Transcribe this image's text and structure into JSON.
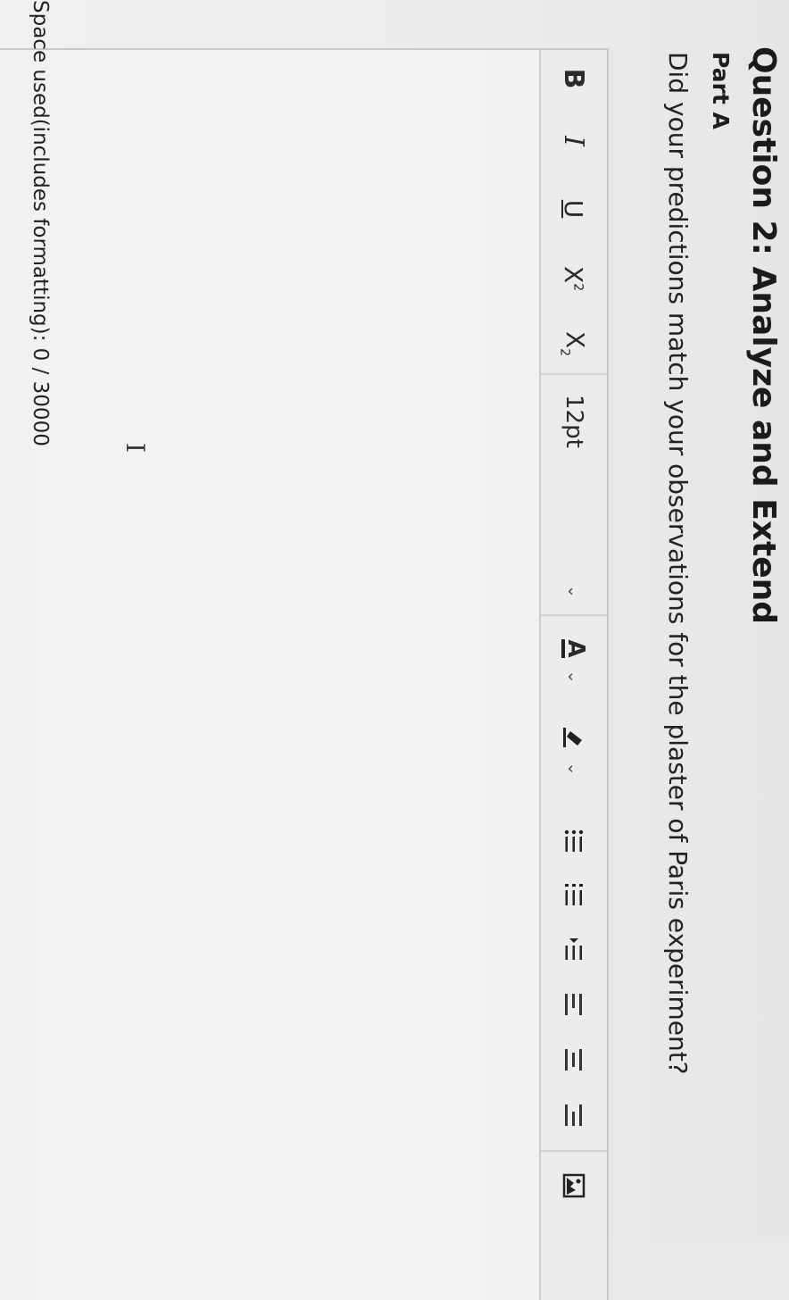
{
  "question": {
    "title": "Question 2: Analyze and Extend",
    "part": "Part A",
    "prompt": "Did your predictions match your observations for the plaster of Paris experiment?"
  },
  "toolbar": {
    "bold": "B",
    "italic": "I",
    "underline": "U",
    "superscript_base": "X",
    "superscript_mark": "2",
    "subscript_base": "X",
    "subscript_mark": "2",
    "font_size": "12pt",
    "font_color_letter": "A",
    "chevron": "⌄",
    "icons": {
      "bold": "bold-icon",
      "italic": "italic-icon",
      "underline": "underline-icon",
      "font_color": "font-color-icon",
      "highlight": "highlight-icon",
      "bullets": "bullet-list-icon",
      "numbers": "numbered-list-icon",
      "indent": "indent-icon",
      "align_left": "align-left-icon",
      "align_center": "align-center-icon",
      "align_right": "align-right-icon",
      "image": "image-icon"
    }
  },
  "editor": {
    "cursor_glyph": "I"
  },
  "footer": {
    "space_used": "Space used(includes formatting): 0 / 30000"
  }
}
